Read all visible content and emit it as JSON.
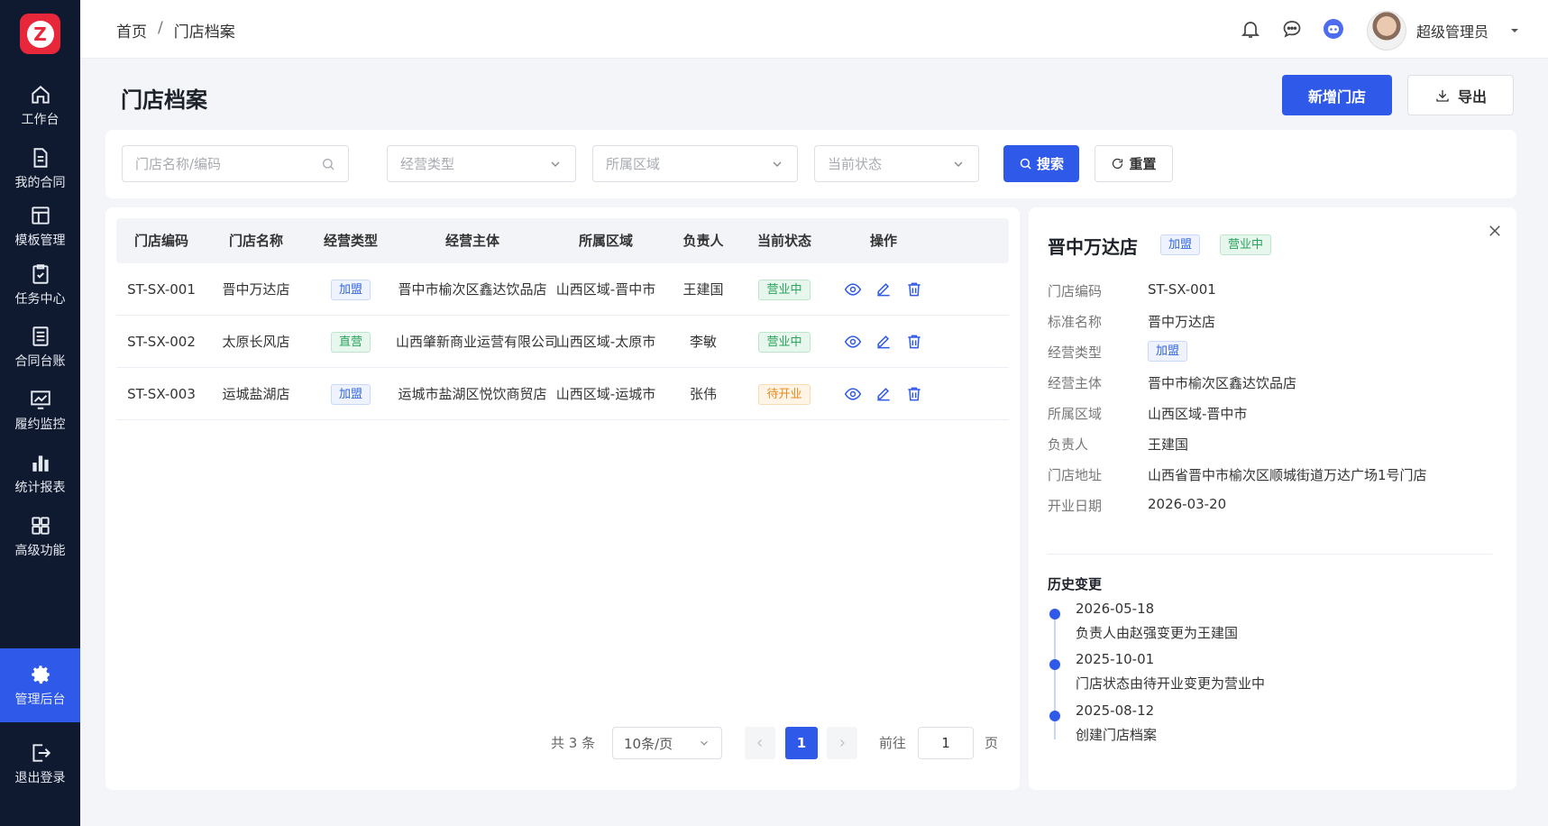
{
  "app": {
    "logo_letter": "Z"
  },
  "sidebar": {
    "items": [
      {
        "label": "工作台",
        "icon": "home-icon"
      },
      {
        "label": "我的合同",
        "icon": "document-icon"
      },
      {
        "label": "模板管理",
        "icon": "template-icon"
      },
      {
        "label": "任务中心",
        "icon": "clipboard-icon"
      },
      {
        "label": "合同台账",
        "icon": "ledger-icon"
      },
      {
        "label": "履约监控",
        "icon": "monitor-chart-icon"
      },
      {
        "label": "统计报表",
        "icon": "bar-chart-icon"
      },
      {
        "label": "高级功能",
        "icon": "grid-icon"
      },
      {
        "label": "管理后台",
        "icon": "gear-icon",
        "active": true
      },
      {
        "label": "退出登录",
        "icon": "logout-icon"
      }
    ]
  },
  "header": {
    "breadcrumb": [
      "首页",
      "门店档案"
    ],
    "breadcrumb_sep": "/",
    "username": "超级管理员"
  },
  "page": {
    "title": "门店档案",
    "add_label": "新增门店",
    "export_label": "导出"
  },
  "filters": {
    "keyword_placeholder": "门店名称/编码",
    "type_placeholder": "经营类型",
    "region_placeholder": "所属区域",
    "status_placeholder": "当前状态",
    "search_label": "搜索",
    "reset_label": "重置"
  },
  "table": {
    "columns": [
      "门店编码",
      "门店名称",
      "经营类型",
      "经营主体",
      "所属区域",
      "负责人",
      "当前状态",
      "操作"
    ],
    "rows": [
      {
        "code": "ST-SX-001",
        "name": "晋中万达店",
        "type": "加盟",
        "type_color": "blue",
        "entity": "晋中市榆次区鑫达饮品店",
        "region": "山西区域-晋中市",
        "owner": "王建国",
        "status": "营业中",
        "status_color": "green"
      },
      {
        "code": "ST-SX-002",
        "name": "太原长风店",
        "type": "直营",
        "type_color": "green",
        "entity": "山西肇新商业运营有限公司",
        "region": "山西区域-太原市",
        "owner": "李敏",
        "status": "营业中",
        "status_color": "green"
      },
      {
        "code": "ST-SX-003",
        "name": "运城盐湖店",
        "type": "加盟",
        "type_color": "blue",
        "entity": "运城市盐湖区悦饮商贸店",
        "region": "山西区域-运城市",
        "owner": "张伟",
        "status": "待开业",
        "status_color": "orange"
      }
    ]
  },
  "pagination": {
    "total_text": "共 3 条",
    "page_size": "10条/页",
    "current_page": "1",
    "goto_label": "前往",
    "goto_value": "1",
    "page_label": "页"
  },
  "detail": {
    "title": "晋中万达店",
    "type_tag": "加盟",
    "status_tag": "营业中",
    "fields": [
      {
        "key": "门店编码",
        "value": "ST-SX-001"
      },
      {
        "key": "标准名称",
        "value": "晋中万达店"
      },
      {
        "key": "经营类型",
        "value": "加盟",
        "is_tag": true
      },
      {
        "key": "经营主体",
        "value": "晋中市榆次区鑫达饮品店"
      },
      {
        "key": "所属区域",
        "value": "山西区域-晋中市"
      },
      {
        "key": "负责人",
        "value": "王建国"
      },
      {
        "key": "门店地址",
        "value": "山西省晋中市榆次区顺城街道万达广场1号门店"
      },
      {
        "key": "开业日期",
        "value": "2026-03-20"
      }
    ],
    "history_title": "历史变更",
    "history": [
      {
        "date": "2026-05-18",
        "desc": "负责人由赵强变更为王建国"
      },
      {
        "date": "2025-10-01",
        "desc": "门店状态由待开业变更为营业中"
      },
      {
        "date": "2025-08-12",
        "desc": "创建门店档案"
      }
    ]
  },
  "colors": {
    "sidebar_bg": "#0f1a30",
    "primary": "#2f59e8",
    "tag_blue": "#3366e0",
    "tag_green": "#27a35a",
    "tag_orange": "#e68a1a"
  }
}
